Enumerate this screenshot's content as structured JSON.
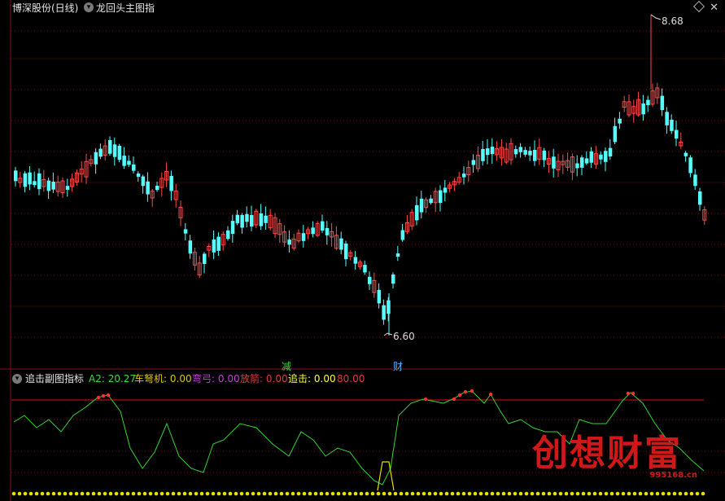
{
  "header": {
    "stock_name": "博深股份(日线)",
    "indicator_name": "龙回头主图指"
  },
  "subpanel": {
    "name": "追击副图指标",
    "fields": [
      {
        "label": "A2:",
        "value": "20.27",
        "color": "#3cdc3c"
      },
      {
        "label": "车弩机:",
        "value": "0.00",
        "color": "#dcc800"
      },
      {
        "label": "弯弓:",
        "value": "0.00",
        "color": "#c83cdc"
      },
      {
        "label": "放箭:",
        "value": "0.00",
        "color": "#dc3c3c"
      },
      {
        "label": "追击:",
        "value": "0.00",
        "color": "#ffff40"
      },
      {
        "label": "",
        "value": "80.00",
        "color": "#dc3c3c"
      }
    ]
  },
  "markers": {
    "high": "8.68",
    "low": "6.60",
    "signal_sell": "减",
    "signal_buy": "财"
  },
  "watermark": {
    "text": "创想财富",
    "site": "995168.cn"
  },
  "colors": {
    "up": "#ff4a4a",
    "down": "#55ffff",
    "grid": "#8a1010",
    "a2_line": "#31d631",
    "hline": "#e01010",
    "yellow": "#e8e000"
  }
}
